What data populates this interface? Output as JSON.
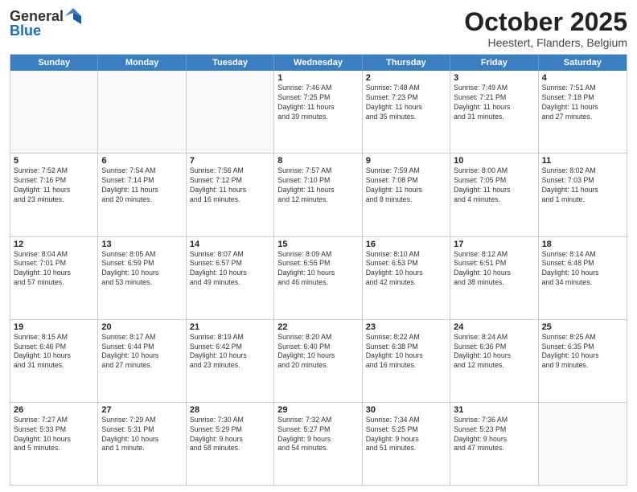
{
  "header": {
    "logo": {
      "line1": "General",
      "line2": "Blue"
    },
    "month": "October 2025",
    "location": "Heestert, Flanders, Belgium"
  },
  "weekdays": [
    "Sunday",
    "Monday",
    "Tuesday",
    "Wednesday",
    "Thursday",
    "Friday",
    "Saturday"
  ],
  "rows": [
    [
      {
        "day": "",
        "text": ""
      },
      {
        "day": "",
        "text": ""
      },
      {
        "day": "",
        "text": ""
      },
      {
        "day": "1",
        "text": "Sunrise: 7:46 AM\nSunset: 7:25 PM\nDaylight: 11 hours\nand 39 minutes."
      },
      {
        "day": "2",
        "text": "Sunrise: 7:48 AM\nSunset: 7:23 PM\nDaylight: 11 hours\nand 35 minutes."
      },
      {
        "day": "3",
        "text": "Sunrise: 7:49 AM\nSunset: 7:21 PM\nDaylight: 11 hours\nand 31 minutes."
      },
      {
        "day": "4",
        "text": "Sunrise: 7:51 AM\nSunset: 7:18 PM\nDaylight: 11 hours\nand 27 minutes."
      }
    ],
    [
      {
        "day": "5",
        "text": "Sunrise: 7:52 AM\nSunset: 7:16 PM\nDaylight: 11 hours\nand 23 minutes."
      },
      {
        "day": "6",
        "text": "Sunrise: 7:54 AM\nSunset: 7:14 PM\nDaylight: 11 hours\nand 20 minutes."
      },
      {
        "day": "7",
        "text": "Sunrise: 7:56 AM\nSunset: 7:12 PM\nDaylight: 11 hours\nand 16 minutes."
      },
      {
        "day": "8",
        "text": "Sunrise: 7:57 AM\nSunset: 7:10 PM\nDaylight: 11 hours\nand 12 minutes."
      },
      {
        "day": "9",
        "text": "Sunrise: 7:59 AM\nSunset: 7:08 PM\nDaylight: 11 hours\nand 8 minutes."
      },
      {
        "day": "10",
        "text": "Sunrise: 8:00 AM\nSunset: 7:05 PM\nDaylight: 11 hours\nand 4 minutes."
      },
      {
        "day": "11",
        "text": "Sunrise: 8:02 AM\nSunset: 7:03 PM\nDaylight: 11 hours\nand 1 minute."
      }
    ],
    [
      {
        "day": "12",
        "text": "Sunrise: 8:04 AM\nSunset: 7:01 PM\nDaylight: 10 hours\nand 57 minutes."
      },
      {
        "day": "13",
        "text": "Sunrise: 8:05 AM\nSunset: 6:59 PM\nDaylight: 10 hours\nand 53 minutes."
      },
      {
        "day": "14",
        "text": "Sunrise: 8:07 AM\nSunset: 6:57 PM\nDaylight: 10 hours\nand 49 minutes."
      },
      {
        "day": "15",
        "text": "Sunrise: 8:09 AM\nSunset: 6:55 PM\nDaylight: 10 hours\nand 46 minutes."
      },
      {
        "day": "16",
        "text": "Sunrise: 8:10 AM\nSunset: 6:53 PM\nDaylight: 10 hours\nand 42 minutes."
      },
      {
        "day": "17",
        "text": "Sunrise: 8:12 AM\nSunset: 6:51 PM\nDaylight: 10 hours\nand 38 minutes."
      },
      {
        "day": "18",
        "text": "Sunrise: 8:14 AM\nSunset: 6:48 PM\nDaylight: 10 hours\nand 34 minutes."
      }
    ],
    [
      {
        "day": "19",
        "text": "Sunrise: 8:15 AM\nSunset: 6:46 PM\nDaylight: 10 hours\nand 31 minutes."
      },
      {
        "day": "20",
        "text": "Sunrise: 8:17 AM\nSunset: 6:44 PM\nDaylight: 10 hours\nand 27 minutes."
      },
      {
        "day": "21",
        "text": "Sunrise: 8:19 AM\nSunset: 6:42 PM\nDaylight: 10 hours\nand 23 minutes."
      },
      {
        "day": "22",
        "text": "Sunrise: 8:20 AM\nSunset: 6:40 PM\nDaylight: 10 hours\nand 20 minutes."
      },
      {
        "day": "23",
        "text": "Sunrise: 8:22 AM\nSunset: 6:38 PM\nDaylight: 10 hours\nand 16 minutes."
      },
      {
        "day": "24",
        "text": "Sunrise: 8:24 AM\nSunset: 6:36 PM\nDaylight: 10 hours\nand 12 minutes."
      },
      {
        "day": "25",
        "text": "Sunrise: 8:25 AM\nSunset: 6:35 PM\nDaylight: 10 hours\nand 9 minutes."
      }
    ],
    [
      {
        "day": "26",
        "text": "Sunrise: 7:27 AM\nSunset: 5:33 PM\nDaylight: 10 hours\nand 5 minutes."
      },
      {
        "day": "27",
        "text": "Sunrise: 7:29 AM\nSunset: 5:31 PM\nDaylight: 10 hours\nand 1 minute."
      },
      {
        "day": "28",
        "text": "Sunrise: 7:30 AM\nSunset: 5:29 PM\nDaylight: 9 hours\nand 58 minutes."
      },
      {
        "day": "29",
        "text": "Sunrise: 7:32 AM\nSunset: 5:27 PM\nDaylight: 9 hours\nand 54 minutes."
      },
      {
        "day": "30",
        "text": "Sunrise: 7:34 AM\nSunset: 5:25 PM\nDaylight: 9 hours\nand 51 minutes."
      },
      {
        "day": "31",
        "text": "Sunrise: 7:36 AM\nSunset: 5:23 PM\nDaylight: 9 hours\nand 47 minutes."
      },
      {
        "day": "",
        "text": ""
      }
    ]
  ]
}
